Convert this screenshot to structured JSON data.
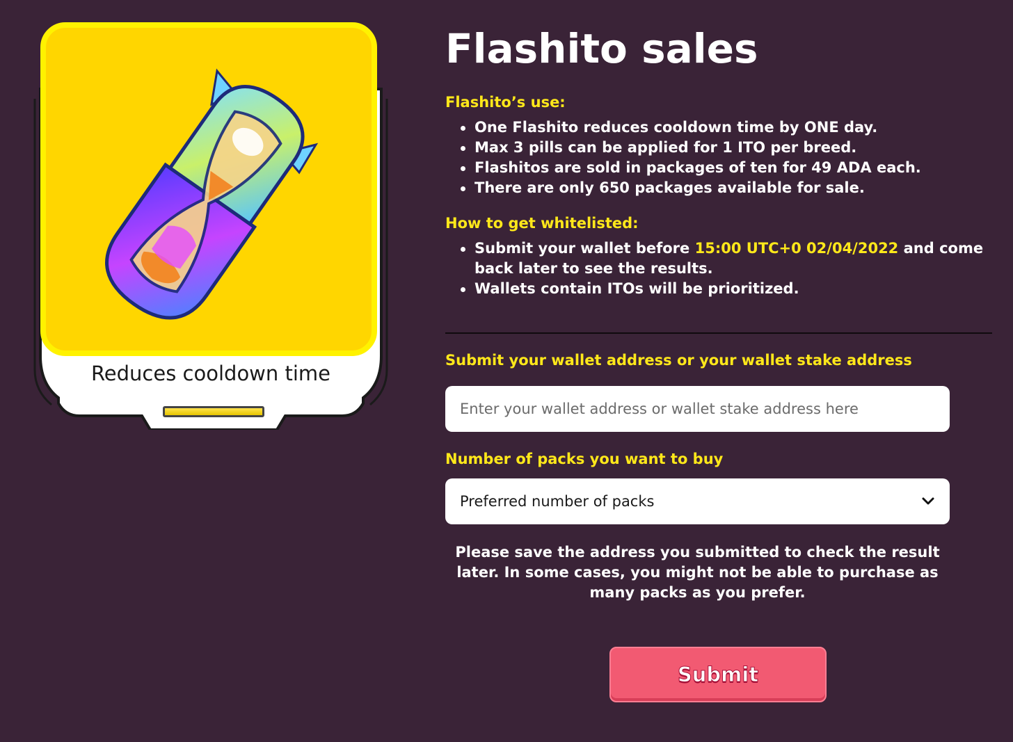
{
  "card": {
    "caption": "Reduces cooldown time",
    "image": "flashito-pill-hourglass-illustration",
    "colors": {
      "background": "#ffd600",
      "border": "#fff200"
    }
  },
  "header": {
    "title": "Flashito sales"
  },
  "use_section": {
    "heading": "Flashito’s use:",
    "items": [
      "One Flashito reduces cooldown time by ONE day.",
      "Max 3 pills can be applied for 1 ITO per breed.",
      "Flashitos are sold in packages of ten for 49 ADA each.",
      "There are only 650 packages available for sale."
    ]
  },
  "whitelist_section": {
    "heading": "How to get whitelisted:",
    "item1_prefix": "Submit your wallet before ",
    "item1_highlight": "15:00 UTC+0 02/04/2022",
    "item1_suffix": " and come back later to see the results.",
    "item2": "Wallets contain ITOs will be prioritized."
  },
  "form": {
    "wallet_label": "Submit your wallet address or your wallet stake address",
    "wallet_placeholder": "Enter your wallet address or wallet stake address here",
    "wallet_value": "",
    "packs_label": "Number of packs you want to buy",
    "packs_selected": "Preferred number of packs",
    "note": "Please save the address you submitted to check the result later. In some cases, you might not be able to purchase as many packs as you prefer.",
    "submit_label": "Submit"
  },
  "colors": {
    "background": "#3a2337",
    "accent_yellow": "#ffe81a",
    "submit_button": "#f25a72"
  }
}
